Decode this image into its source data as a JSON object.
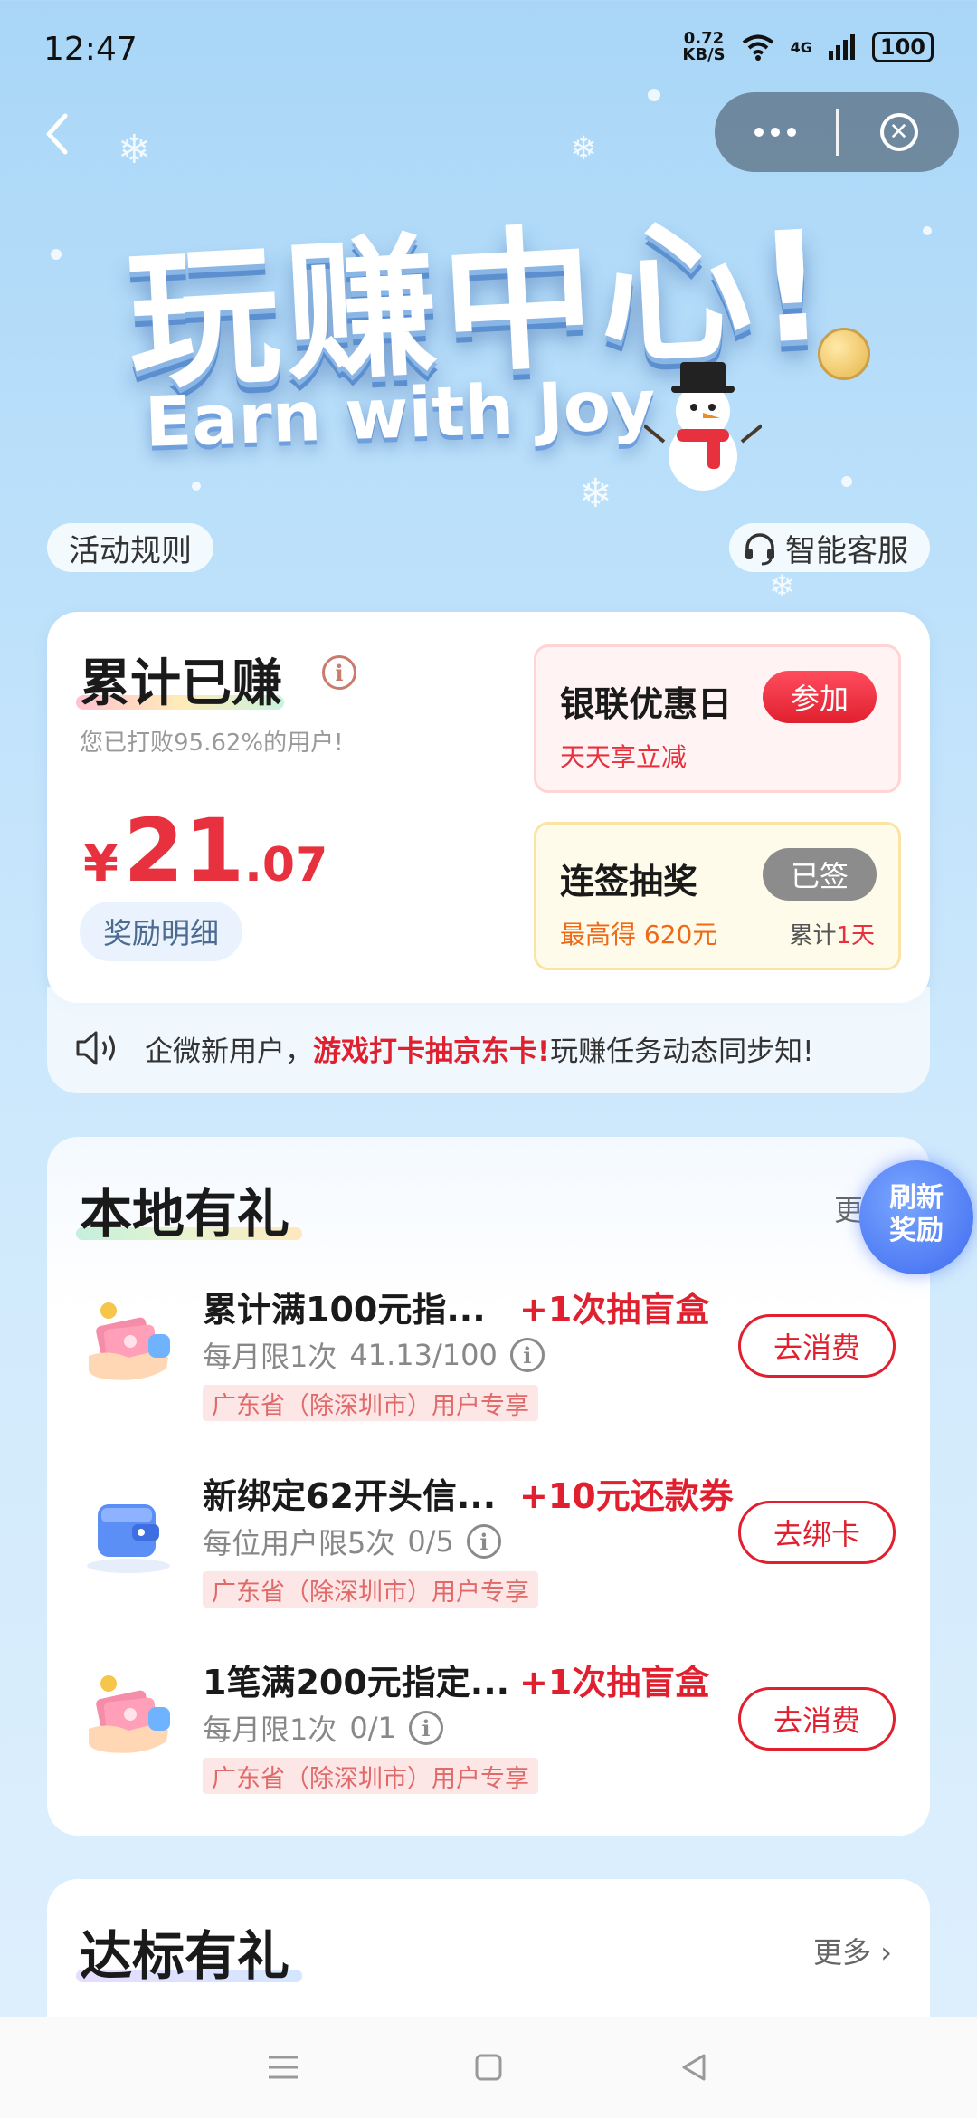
{
  "status_bar": {
    "time": "12:47",
    "speed_value": "0.72",
    "speed_unit": "KB/S",
    "network": "4G",
    "battery": "100"
  },
  "banner": {
    "title_cn": "玩赚中心!",
    "title_en": "Earn with Joy"
  },
  "header_links": {
    "rules": "活动规则",
    "service": "智能客服"
  },
  "earnings": {
    "title": "累计已赚",
    "beat_text": "您已打败95.62%的用户!",
    "currency": "¥",
    "amount_int": "21",
    "amount_dec": ".07",
    "detail_btn": "奖励明细"
  },
  "unionpay_day": {
    "title": "银联优惠日",
    "button": "参加",
    "subtitle": "天天享立减"
  },
  "sign_lottery": {
    "title": "连签抽奖",
    "button": "已签",
    "max_reward": "最高得 620元",
    "streak_prefix": "累计",
    "streak_days": "1天"
  },
  "notice": {
    "part1": "企微新用户，",
    "highlight": "游戏打卡抽京东卡!",
    "part2": " 玩赚任务动态同步知!"
  },
  "local_gifts": {
    "title": "本地有礼",
    "more": "更多",
    "refresh": [
      "刷新",
      "奖励"
    ],
    "tasks": [
      {
        "name": "累计满100元指...",
        "reward": "+1次抽盲盒",
        "limit": "每月限1次",
        "progress": "41.13/100",
        "tag": "广东省（除深圳市）用户专享",
        "button": "去消费",
        "icon": "cash-hand-icon"
      },
      {
        "name": "新绑定62开头信...",
        "reward": "+10元还款券",
        "limit": "每位用户限5次",
        "progress": "0/5",
        "tag": "广东省（除深圳市）用户专享",
        "button": "去绑卡",
        "icon": "wallet-icon"
      },
      {
        "name": "1笔满200元指定...",
        "reward": "+1次抽盲盒",
        "limit": "每月限1次",
        "progress": "0/1",
        "tag": "广东省（除深圳市）用户专享",
        "button": "去消费",
        "icon": "cash-hand-icon"
      }
    ]
  },
  "reach_gifts": {
    "title": "达标有礼",
    "more": "更多 ›"
  },
  "colors": {
    "accent_red": "#e0202f",
    "background": "#bfe2fb"
  }
}
